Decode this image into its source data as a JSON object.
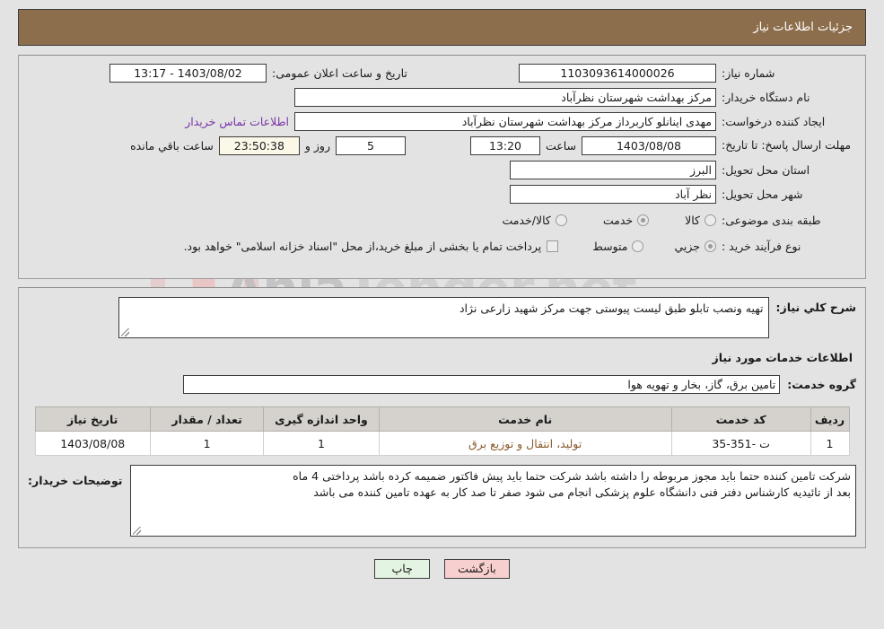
{
  "header": {
    "title": "جزئیات اطلاعات نیاز"
  },
  "fields": {
    "need_number_label": "شماره نیاز:",
    "need_number_value": "1103093614000026",
    "announce_label": "تاریخ و ساعت اعلان عمومی:",
    "announce_value": "1403/08/02 - 13:17",
    "buyer_org_label": "نام دستگاه خریدار:",
    "buyer_org_value": "مرکز بهداشت شهرستان نظرآباد",
    "creator_label": "ایجاد کننده درخواست:",
    "creator_value": "مهدی اینانلو کاربرداز مرکز بهداشت شهرستان نظرآباد",
    "contact_link": "اطلاعات تماس خریدار",
    "deadline_label": "مهلت ارسال پاسخ: تا تاریخ:",
    "deadline_date": "1403/08/08",
    "deadline_hour_label": "ساعت",
    "deadline_time": "13:20",
    "remaining_days": "5",
    "remaining_days_label": "روز و",
    "remaining_clock": "23:50:38",
    "remaining_clock_label": "ساعت باقي مانده",
    "province_label": "استان محل تحویل:",
    "province_value": "البرز",
    "city_label": "شهر محل تحویل:",
    "city_value": "نظر آباد",
    "category_label": "طبقه بندی موضوعی:",
    "category_options": [
      "کالا",
      "خدمت",
      "کالا/خدمت"
    ],
    "category_selected": "خدمت",
    "process_label": "نوع فرآیند خرید :",
    "process_options": [
      "جزیي",
      "متوسط"
    ],
    "process_selected": "جزیي",
    "treasury_note": "پرداخت تمام یا بخشی از مبلغ خرید،از محل \"اسناد خزانه اسلامی\" خواهد بود."
  },
  "description": {
    "label": "شرح کلي نیاز:",
    "value": "تهیه ونصب تابلو طبق لیست پیوستی جهت مرکز شهید زارعی نژاد"
  },
  "services": {
    "section_title": "اطلاعات خدمات مورد نیاز",
    "group_label": "گروه خدمت:",
    "group_value": "تامین برق، گاز، بخار و تهویه هوا",
    "columns": [
      "ردیف",
      "کد خدمت",
      "نام خدمت",
      "واحد اندازه گیری",
      "تعداد / مقدار",
      "تاریخ نیاز"
    ],
    "rows": [
      {
        "radif": "1",
        "code": "ت -351-35",
        "name": "تولید، انتقال و توزیع برق",
        "unit": "1",
        "qty": "1",
        "date": "1403/08/08"
      }
    ]
  },
  "notes": {
    "label": "توضیحات خریدار:",
    "line1": "شرکت تامین کننده حتما باید مجوز مربوطه را داشته باشد شرکت حتما باید پیش فاکتور ضمیمه کرده باشد پرداختی 4 ماه",
    "line2": "بعد از تائیدیه کارشناس دفتر فنی دانشگاه علوم پزشکی انجام می شود صفر تا صد کار به عهده تامین کننده می باشد"
  },
  "footer": {
    "back_label": "بازگشت",
    "print_label": "چاپ"
  },
  "watermark": {
    "text_left": "Anla",
    "text_right": "Tender.net"
  },
  "colors": {
    "header_bg": "#8d6e4c",
    "page_bg": "#e3e3e3",
    "link": "#7a34a8",
    "service_name": "#8a5a2b",
    "countdown_bg": "#fbf8e8",
    "back_btn": "#f8cfcf",
    "print_btn": "#e4f4e2"
  }
}
